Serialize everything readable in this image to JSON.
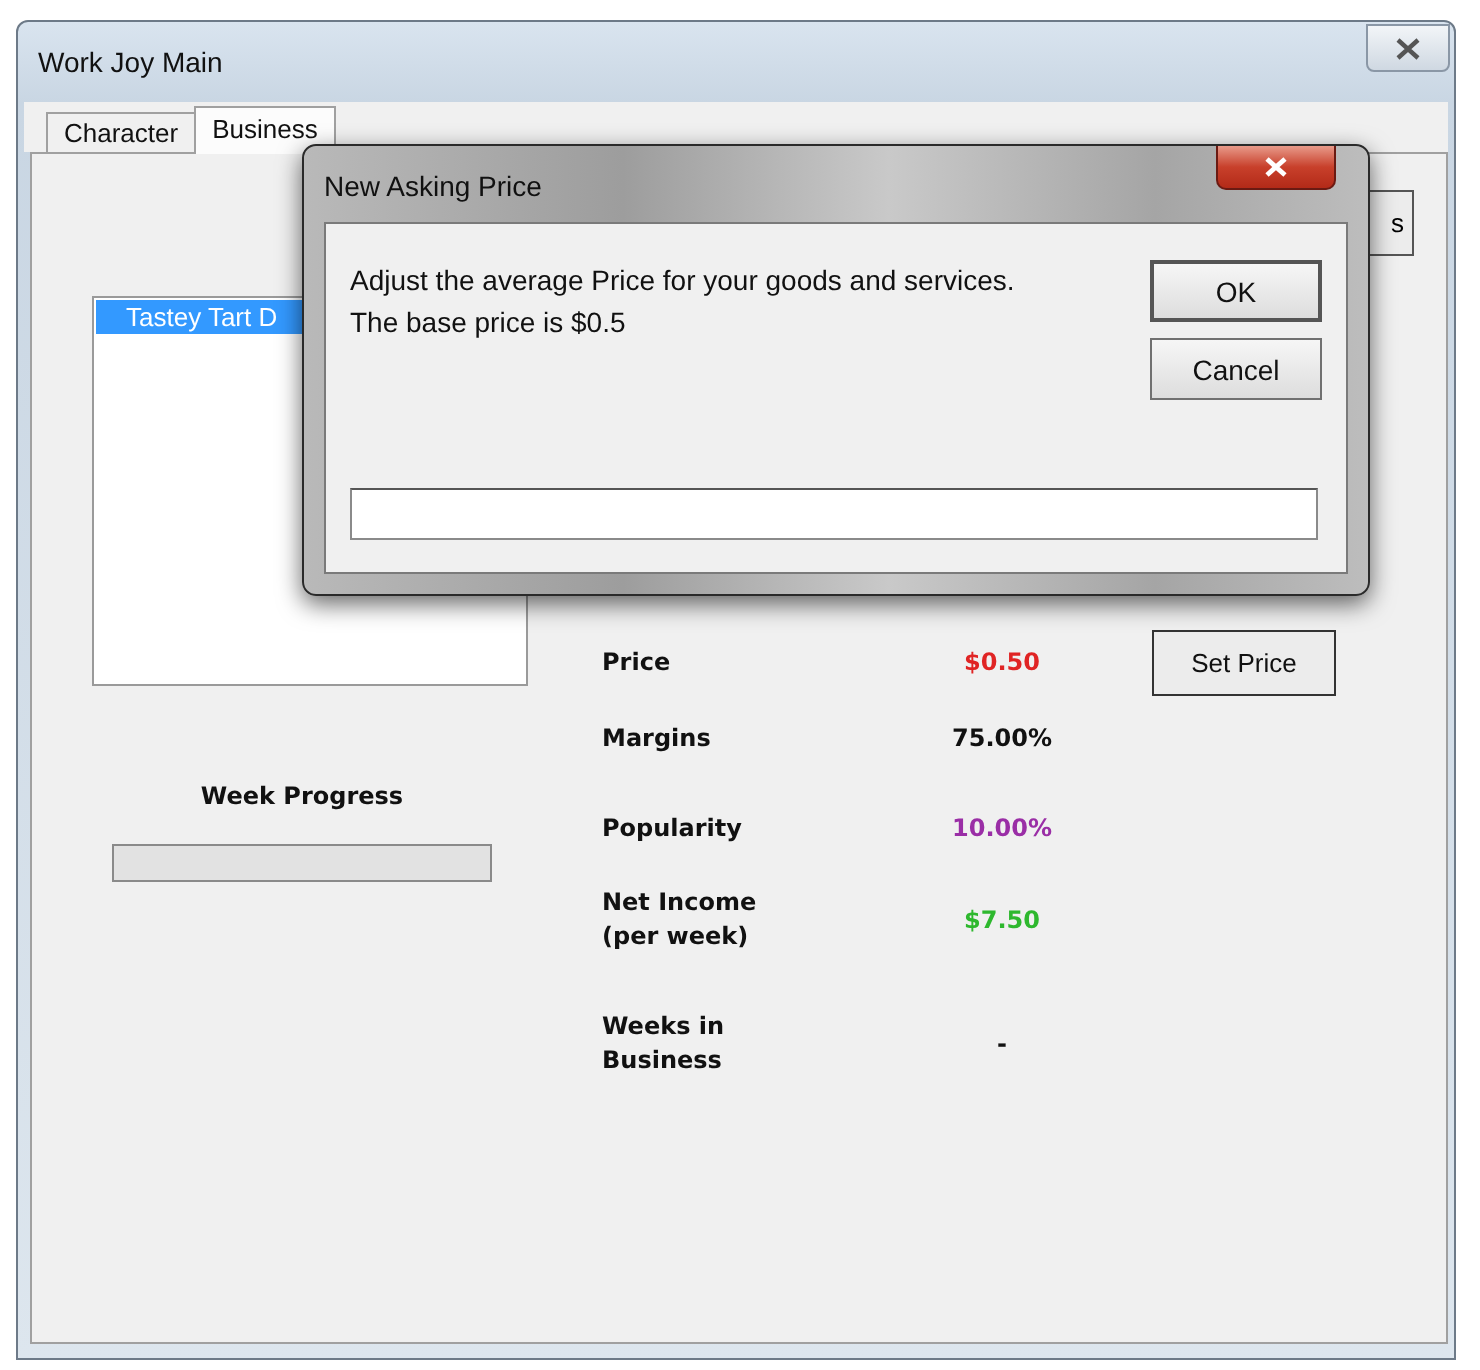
{
  "window": {
    "title": "Work Joy Main"
  },
  "tabs": [
    {
      "label": "Character",
      "selected": false
    },
    {
      "label": "Business",
      "selected": true
    }
  ],
  "partial_button": {
    "label": "s"
  },
  "listbox": {
    "items": [
      {
        "label": "Tastey Tart D",
        "selected": true
      }
    ]
  },
  "week_progress": {
    "label": "Week Progress",
    "level": 0
  },
  "stats": [
    {
      "label": "Price",
      "value": "$0.50",
      "color": "#e02424"
    },
    {
      "label": "Margins",
      "value": "75.00%",
      "color": "#111111"
    },
    {
      "label": "Popularity",
      "value": "10.00%",
      "color": "#9a2ea6"
    },
    {
      "label": "Net Income\n(per week)",
      "value": "$7.50",
      "color": "#2eb82e"
    },
    {
      "label": "Weeks in\nBusiness",
      "value": "-",
      "color": "#111111"
    }
  ],
  "set_price_button": {
    "label": "Set Price"
  },
  "dialog": {
    "title": "New Asking Price",
    "message": "Adjust the average Price for your goods and services. The base price is $0.5",
    "buttons": [
      {
        "label": "OK",
        "default": true
      },
      {
        "label": "Cancel",
        "default": false
      }
    ]
  }
}
